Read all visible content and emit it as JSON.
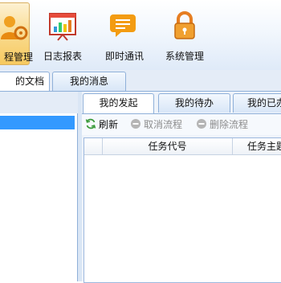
{
  "ribbon": {
    "items": [
      {
        "label": "程管理",
        "icon": "process-management-icon",
        "active": true
      },
      {
        "label": "日志报表",
        "icon": "report-chart-icon",
        "active": false
      },
      {
        "label": "即时通讯",
        "icon": "instant-message-icon",
        "active": false
      },
      {
        "label": "系统管理",
        "icon": "system-lock-icon",
        "active": false
      }
    ]
  },
  "main_tabs": [
    {
      "label": "的文档",
      "active": true
    },
    {
      "label": "我的消息",
      "active": false
    }
  ],
  "workflow_tabs": [
    {
      "label": "我的发起",
      "active": true
    },
    {
      "label": "我的待办",
      "active": false
    },
    {
      "label": "我的已办",
      "active": false
    }
  ],
  "toolbar": {
    "refresh": "刷新",
    "cancel_flow": "取消流程",
    "delete_flow": "删除流程"
  },
  "grid": {
    "columns": [
      "任务代号",
      "任务主题"
    ]
  },
  "colors": {
    "selection": "#3399ff",
    "active_ribbon": "#f6c95f",
    "border": "#8fb0d9"
  }
}
